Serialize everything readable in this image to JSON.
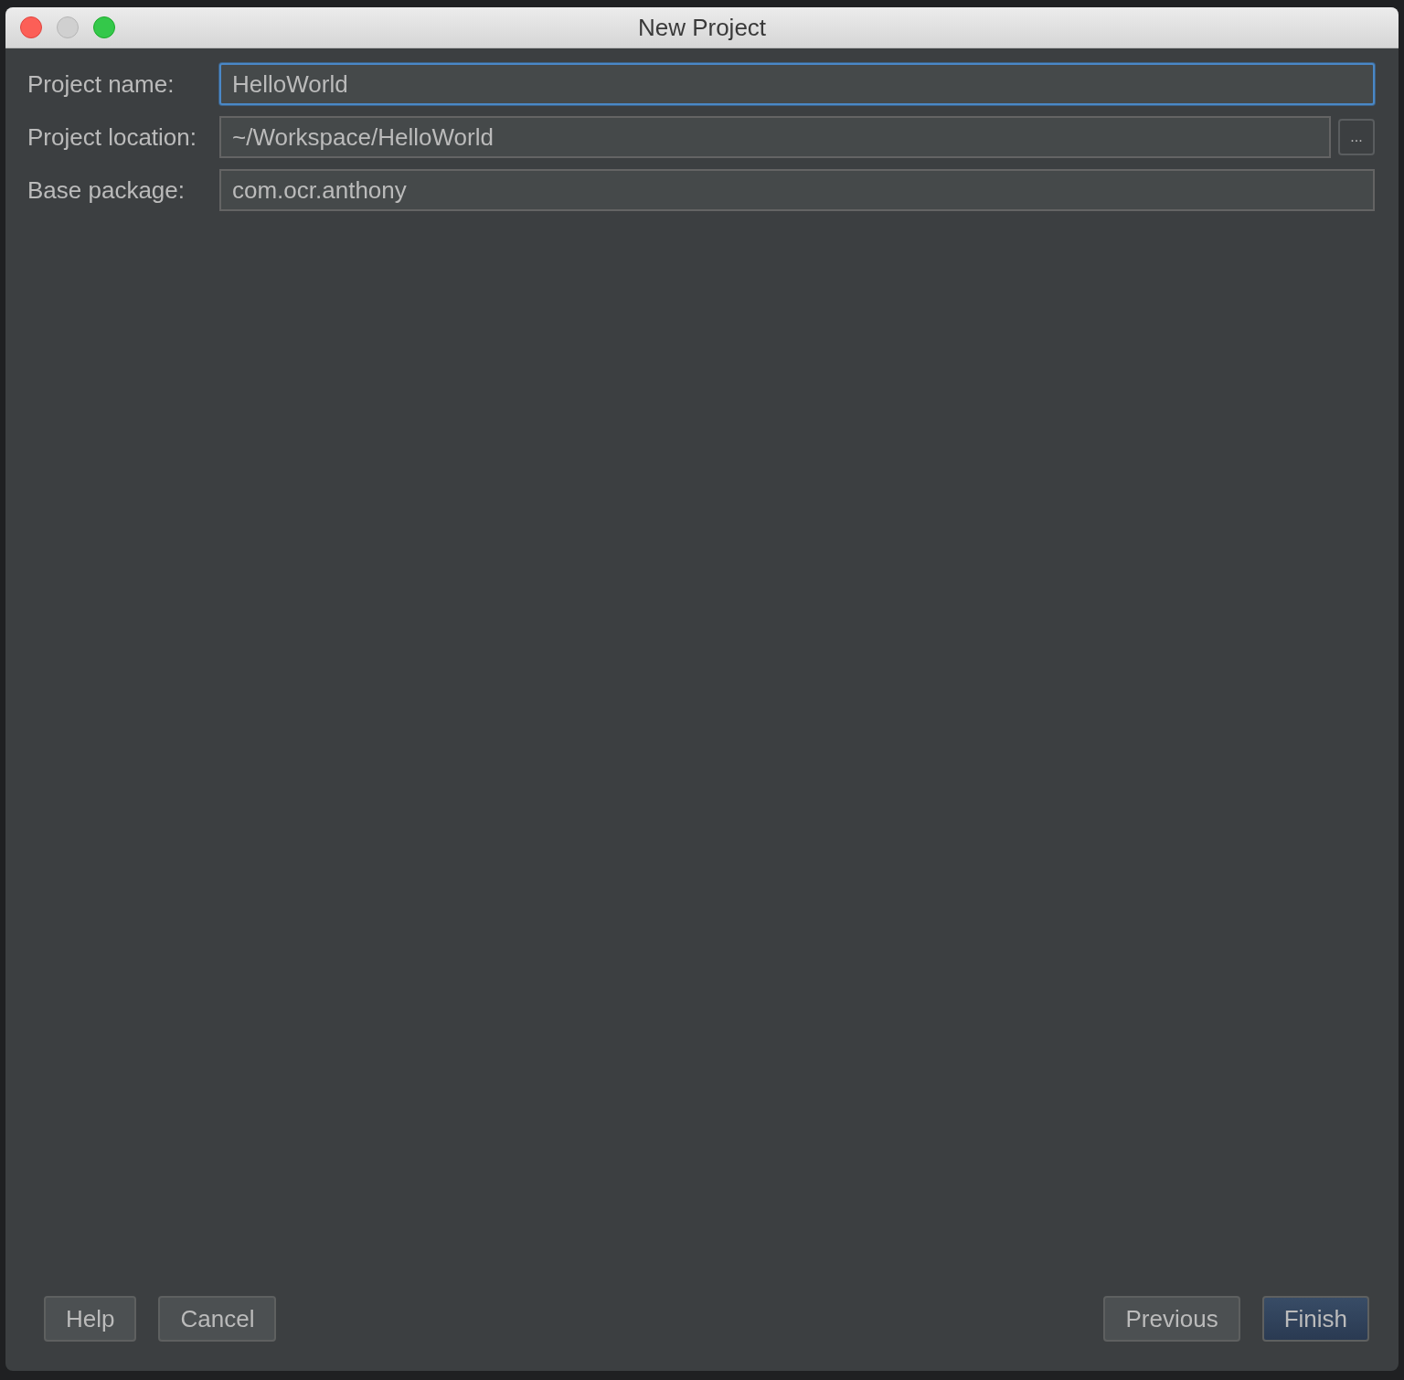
{
  "window": {
    "title": "New Project"
  },
  "fields": [
    {
      "label": "Project name:",
      "value": "HelloWorld",
      "focused": true,
      "browse": false
    },
    {
      "label": "Project location:",
      "value": "~/Workspace/HelloWorld",
      "focused": false,
      "browse": true,
      "browse_label": "..."
    },
    {
      "label": "Base package:",
      "value": "com.ocr.anthony",
      "focused": false,
      "browse": false
    }
  ],
  "buttons_left": [
    {
      "label": "Help",
      "default": false
    },
    {
      "label": "Cancel",
      "default": false
    }
  ],
  "buttons_right": [
    {
      "label": "Previous",
      "default": false
    },
    {
      "label": "Finish",
      "default": true
    }
  ]
}
